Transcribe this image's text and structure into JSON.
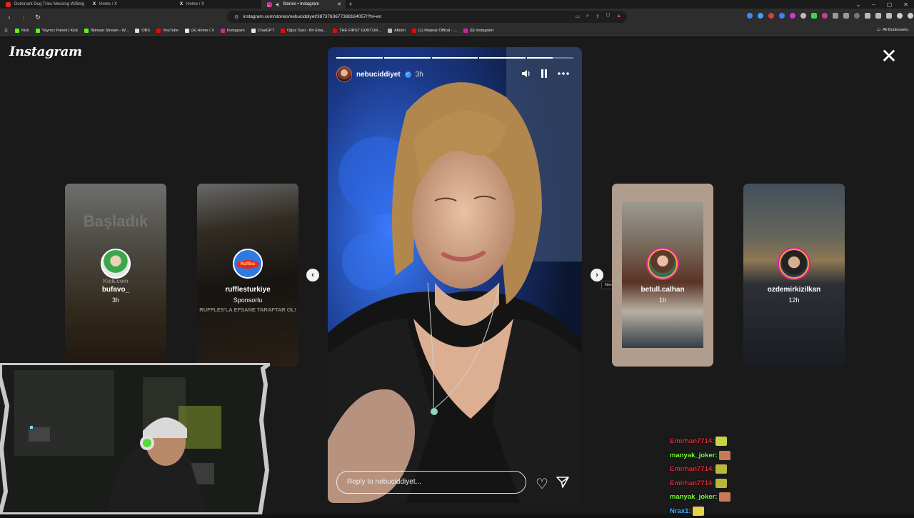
{
  "browser": {
    "tabs": [
      {
        "title": "Dominant Dog Tries Messing W/Belg",
        "color": "#e0281c",
        "active": false
      },
      {
        "title": "Home / X",
        "color": "#e6e6e6",
        "active": false
      },
      {
        "title": "Home / X",
        "color": "#e6e6e6",
        "active": false
      },
      {
        "title": "Stories • Instagram",
        "color": "#d6249f",
        "active": true
      }
    ],
    "url": "instagram.com/stories/nebuciddiyet/3873763677388164057/?hl=en",
    "bookmarks": [
      {
        "label": "Kick",
        "color": "#53fc18"
      },
      {
        "label": "Yayıncı Paneli | Kick",
        "color": "#53fc18"
      },
      {
        "label": "İlkinsan Stream - W...",
        "color": "#53fc18"
      },
      {
        "label": "OBS",
        "color": "#dddddd"
      },
      {
        "label": "YouTube",
        "color": "#ff0000"
      },
      {
        "label": "(4) Home / X",
        "color": "#e6e6e6"
      },
      {
        "label": "Instagram",
        "color": "#d6249f"
      },
      {
        "label": "ChatGPT",
        "color": "#e6e6e6"
      },
      {
        "label": "Oğuz Sasi - Bir Efsa...",
        "color": "#ff0000"
      },
      {
        "label": "THE FIRST GOKTUR...",
        "color": "#ff0000"
      },
      {
        "label": "Albüm",
        "color": "#bbbbbb"
      },
      {
        "label": "(1) Mepraz Offical - ...",
        "color": "#ff0000"
      },
      {
        "label": "(9) Instagram",
        "color": "#d6249f"
      }
    ],
    "all_bookmarks": "All Bookmarks"
  },
  "instagram": {
    "logo": "Instagram",
    "close_symbol": "✕",
    "story": {
      "username": "nebuciddiyet",
      "verified_mark": "✓",
      "time": "3h",
      "progress": [
        1,
        1,
        1,
        1,
        0.55
      ],
      "reply_placeholder": "Reply to nebuciddiyet...",
      "heart_symbol": "♡"
    },
    "prev_symbol": "‹",
    "next_symbol": "›",
    "next_tooltip": "Next",
    "cards": [
      {
        "username": "bufavo_",
        "time": "3h",
        "overlay": "Başladık",
        "overlay_sub": "Kick.com"
      },
      {
        "username": "rufflesturkiye",
        "time": "Sponsorlu",
        "overlay": "RUFFLES'LA EFSANE TARAFTAR OL!",
        "logo_text": "Ruffles"
      },
      {
        "username": "betull.calhan",
        "time": "1h"
      },
      {
        "username": "ozdemirkizilkan",
        "time": "12h"
      }
    ]
  },
  "chat": [
    {
      "user": "Emirhan7714:",
      "color": "#e0283a",
      "emote": "#c9d445"
    },
    {
      "user": "manyak_joker:",
      "color": "#7cff3a",
      "emote": "#c77a5a"
    },
    {
      "user": "Emirhan7714:",
      "color": "#e0283a",
      "emote": "#b8b83a"
    },
    {
      "user": "Emirhan7714:",
      "color": "#e0283a",
      "emote": "#b8b83a"
    },
    {
      "user": "manyak_joker:",
      "color": "#7cff3a",
      "emote": "#c77a5a"
    },
    {
      "user": "Nrax1:",
      "color": "#3ab0ff",
      "emote": "#e3d24a"
    }
  ]
}
